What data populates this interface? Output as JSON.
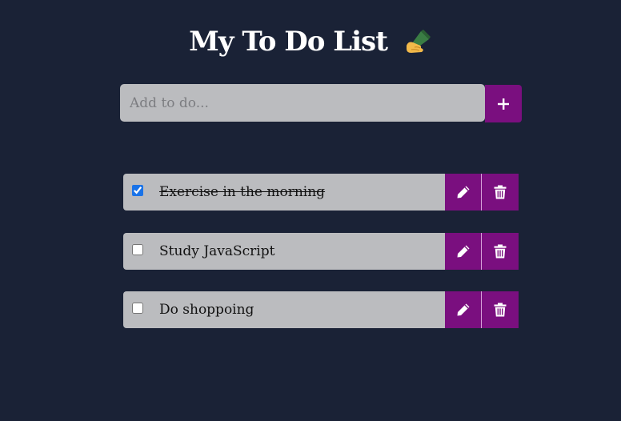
{
  "header": {
    "title": "My To Do List",
    "title_icon": "writing-hand-emoji"
  },
  "add_form": {
    "placeholder": "Add to do...",
    "add_button_icon": "plus-icon"
  },
  "todos": [
    {
      "text": "Exercise in the morning",
      "completed": true
    },
    {
      "text": "Study JavaScript",
      "completed": false
    },
    {
      "text": "Do shoppoing",
      "completed": false
    }
  ],
  "colors": {
    "background": "#1a2236",
    "accent": "#7a0f7f",
    "item_background": "#bbbcbf"
  },
  "icons": {
    "edit": "pencil-icon",
    "delete": "trash-icon"
  }
}
